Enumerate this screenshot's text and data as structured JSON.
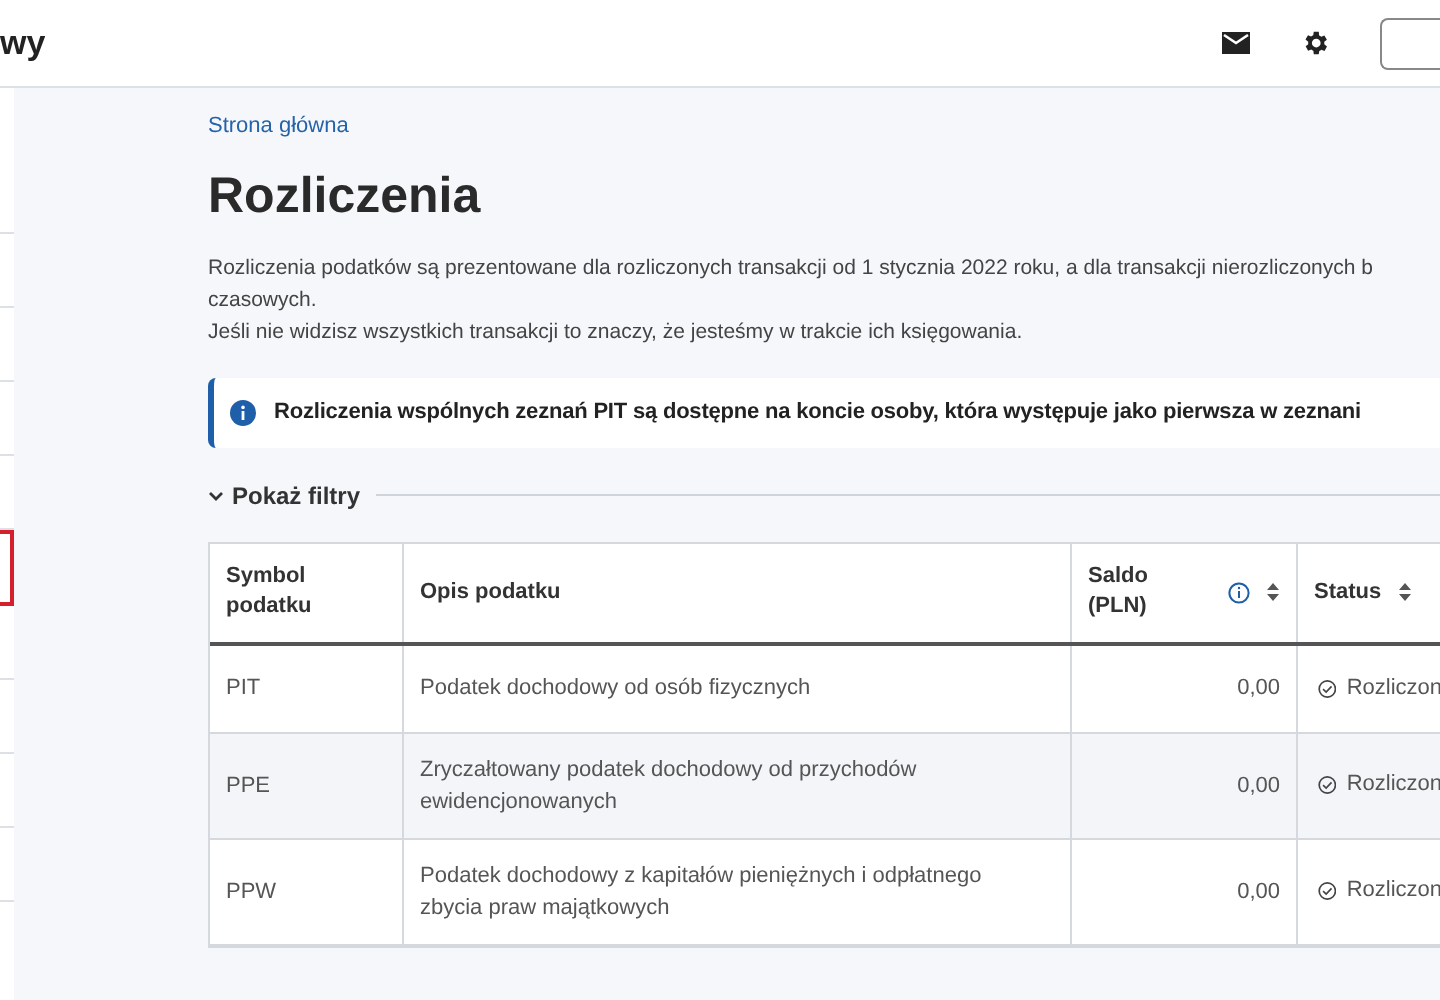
{
  "header": {
    "title": "wy"
  },
  "breadcrumb": "Strona główna",
  "page_title": "Rozliczenia",
  "intro": [
    "Rozliczenia podatków są prezentowane dla rozliczonych transakcji od 1 stycznia 2022 roku, a dla transakcji nierozliczonych b",
    "czasowych.",
    "Jeśli nie widzisz wszystkich transakcji to znaczy, że jesteśmy w trakcie ich księgowania."
  ],
  "info": "Rozliczenia wspólnych zeznań PIT są dostępne na koncie osoby, która występuje jako pierwsza w zeznani",
  "filters": {
    "label": "Pokaż filtry",
    "expanded": false
  },
  "sidebar": {
    "items": [
      {
        "selected": false
      },
      {
        "selected": false
      },
      {
        "selected": false
      },
      {
        "selected": false
      },
      {
        "selected": false
      },
      {
        "selected": true
      },
      {
        "selected": false
      },
      {
        "selected": false
      },
      {
        "selected": false
      },
      {
        "selected": false
      }
    ]
  },
  "table": {
    "columns": [
      {
        "label": "Symbol podatku",
        "sortable": false,
        "info": false
      },
      {
        "label": "Opis podatku",
        "sortable": false,
        "info": false
      },
      {
        "label": "Saldo (PLN)",
        "sortable": true,
        "info": true
      },
      {
        "label": "Status",
        "sortable": true,
        "info": false
      }
    ],
    "rows": [
      {
        "symbol": "PIT",
        "description": "Podatek dochodowy od osób fizycznych",
        "balance": "0,00",
        "status": "Rozliczon"
      },
      {
        "symbol": "PPE",
        "description": "Zryczałtowany podatek dochodowy od przychodów ewidencjonowanych",
        "balance": "0,00",
        "status": "Rozliczon"
      },
      {
        "symbol": "PPW",
        "description": "Podatek dochodowy z kapitałów pieniężnych i odpłatnego zbycia praw majątkowych",
        "balance": "0,00",
        "status": "Rozliczon"
      }
    ]
  }
}
